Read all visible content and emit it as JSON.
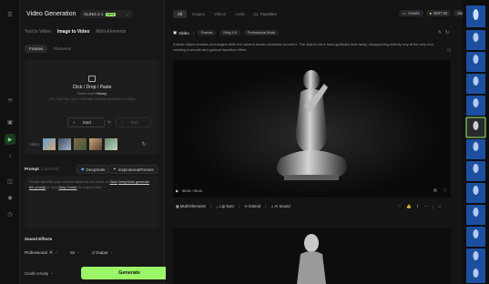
{
  "left": {
    "title": "Video Generation",
    "model_name": "KLING 2.1",
    "model_badge": "NEW",
    "tabs": [
      "Text to Video",
      "Image to Video",
      "Multi-Elements"
    ],
    "subtabs": [
      "Frames",
      "Elements"
    ],
    "upload": {
      "title": "Click / Drop / Paste",
      "history_prefix": "Select from ",
      "history_link": "History",
      "hint": "JPG / PNG files up to 10MB with minimum dimensions of 300px"
    },
    "start_label": "Start",
    "end_label": "End",
    "hints_label": "Hints:",
    "prompt_label": "Prompt",
    "prompt_optional": "(Optional)",
    "deepseek_label": "DeepSeek",
    "inspiration_label": "Inspiration&Presets",
    "prompt_placeholder_parts": {
      "p1": "Please describe your creative ideas for the video, or",
      "link1": "Save",
      "link2": "DeepSeek generate the prompt",
      "p2": "or view",
      "link3": "Help Center",
      "p3": "for a quick start."
    },
    "sound_effects_label": "Sound Effects",
    "mode_value": "Professional",
    "duration_value": "5s",
    "output_value": "2 Output",
    "credit_label": "Credit Activity",
    "generate_label": "Generate"
  },
  "top": {
    "filters": [
      "All",
      "Images",
      "Videos",
      "Audio"
    ],
    "favorites": "Favorites",
    "assets": "Assets",
    "credits": "6607.60",
    "plan": "Standard"
  },
  "video_card": {
    "type_label": "Video",
    "tags": [
      "Frames",
      "Kling 1.6",
      "Professional Mode"
    ],
    "description": "A static object remains unchanged while the camera moves clockwise around it. The object's blue hues gradually fade away, disappearing entirely only at the very end, creating a smooth and gradual transition effect.",
    "time": "00:00 / 00:10",
    "actions": [
      "Multi-Elements",
      "Lip Sync",
      "Extend",
      "AI Sound"
    ]
  },
  "colors": {
    "accent": "#9cf567",
    "bg": "#141414",
    "panel": "#171717"
  }
}
